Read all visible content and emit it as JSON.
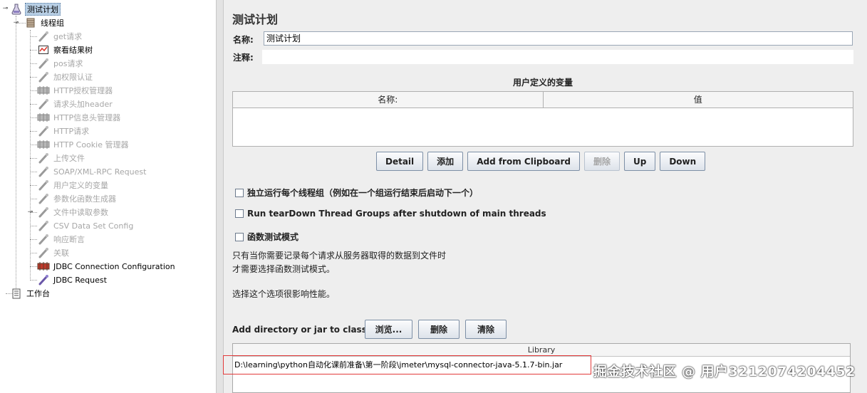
{
  "tree": {
    "root": "测试计划",
    "thread_group": "线程组",
    "children": [
      {
        "label": "get请求",
        "enabled": false,
        "icon": "sampler-icon"
      },
      {
        "label": "察看结果树",
        "enabled": true,
        "icon": "listener-icon"
      },
      {
        "label": "pos请求",
        "enabled": false,
        "icon": "sampler-icon"
      },
      {
        "label": "加权限认证",
        "enabled": false,
        "icon": "sampler-icon"
      },
      {
        "label": "HTTP授权管理器",
        "enabled": false,
        "icon": "config-icon"
      },
      {
        "label": "请求头加header",
        "enabled": false,
        "icon": "sampler-icon"
      },
      {
        "label": "HTTP信息头管理器",
        "enabled": false,
        "icon": "config-icon"
      },
      {
        "label": "HTTP请求",
        "enabled": false,
        "icon": "sampler-icon"
      },
      {
        "label": "HTTP Cookie 管理器",
        "enabled": false,
        "icon": "config-icon"
      },
      {
        "label": "上传文件",
        "enabled": false,
        "icon": "sampler-icon"
      },
      {
        "label": "SOAP/XML-RPC Request",
        "enabled": false,
        "icon": "sampler-icon"
      },
      {
        "label": "用户定义的变量",
        "enabled": false,
        "icon": "sampler-icon"
      },
      {
        "label": "参数化函数生成器",
        "enabled": false,
        "icon": "sampler-icon"
      },
      {
        "label": "文件中读取参数",
        "enabled": false,
        "icon": "sampler-icon"
      },
      {
        "label": "CSV Data Set Config",
        "enabled": false,
        "icon": "sampler-icon"
      },
      {
        "label": "响应断言",
        "enabled": false,
        "icon": "sampler-icon"
      },
      {
        "label": "关联",
        "enabled": false,
        "icon": "sampler-icon"
      },
      {
        "label": "JDBC Connection Configuration",
        "enabled": true,
        "icon": "config-icon"
      },
      {
        "label": "JDBC Request",
        "enabled": true,
        "icon": "sampler-icon"
      }
    ],
    "workbench": "工作台"
  },
  "panel": {
    "title": "测试计划",
    "name_label": "名称:",
    "name_value": "测试计划",
    "comment_label": "注释:",
    "comment_value": "",
    "udv_title": "用户定义的变量",
    "udv_col_name": "名称:",
    "udv_col_value": "值",
    "buttons": [
      "Detail",
      "添加",
      "Add from Clipboard",
      "删除",
      "Up",
      "Down"
    ],
    "chk1": "独立运行每个线程组（例如在一个组运行结束后启动下一个）",
    "chk2": "Run tearDown Thread Groups after shutdown of main threads",
    "chk3": "函数测试模式",
    "desc1": "只有当你需要记录每个请求从服务器取得的数据到文件时",
    "desc2": "才需要选择函数测试模式。",
    "desc3": "选择这个选项很影响性能。",
    "classpath_label": "Add directory or jar to classpath",
    "classpath_buttons": [
      "浏览...",
      "删除",
      "清除"
    ],
    "library_header": "Library",
    "library_row": "D:\\learning\\python自动化课前准备\\第一阶段\\jmeter\\mysql-connector-java-5.1.7-bin.jar"
  },
  "watermark": "掘金技术社区 @ 用户3212074204452"
}
